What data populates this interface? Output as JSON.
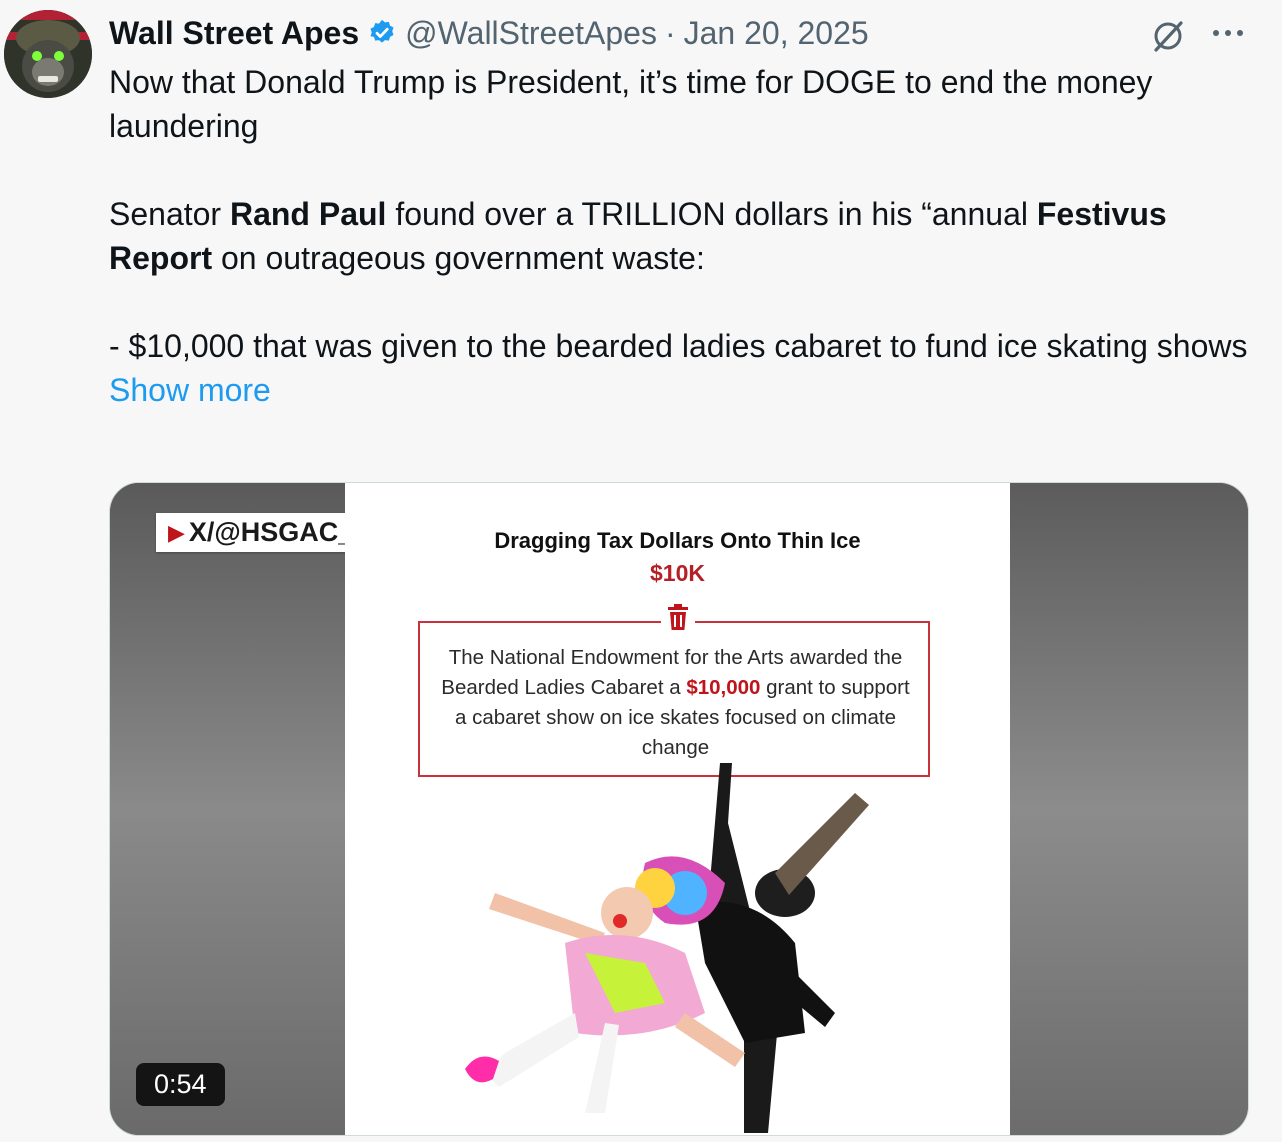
{
  "author": {
    "name": "Wall Street Apes",
    "handle": "@WallStreetApes",
    "separator": "·",
    "date": "Jan 20, 2025"
  },
  "tweet": {
    "line1": "Now that Donald Trump is President, it’s time for DOGE to end the money laundering",
    "p2_pre": "Senator ",
    "p2_bold1": "Rand Paul",
    "p2_mid": " found over a TRILLION dollars in his “annual ",
    "p2_bold2": "Festivus Report",
    "p2_post": " on outrageous government waste:",
    "p3": "- $10,000 that was given to the bearded ladies cabaret to fund ice skating shows",
    "show_more": "Show more"
  },
  "media": {
    "watermark": "X/@HSGAC_GOP",
    "title": "Dragging Tax Dollars Onto Thin Ice",
    "amount": "$10K",
    "body_1": "The National Endowment for the Arts awarded the Bearded Ladies Cabaret a ",
    "body_highlight": "$10,000",
    "body_2": " grant to support a cabaret show on ice skates focused on climate change",
    "duration": "0:54"
  },
  "icons": {
    "verified": "verified-badge-icon",
    "grok": "grok-icon",
    "more": "more-icon",
    "trash": "trash-icon"
  },
  "colors": {
    "link": "#1d9bf0",
    "verified": "#1d9bf0",
    "accent_red": "#b51f25"
  }
}
